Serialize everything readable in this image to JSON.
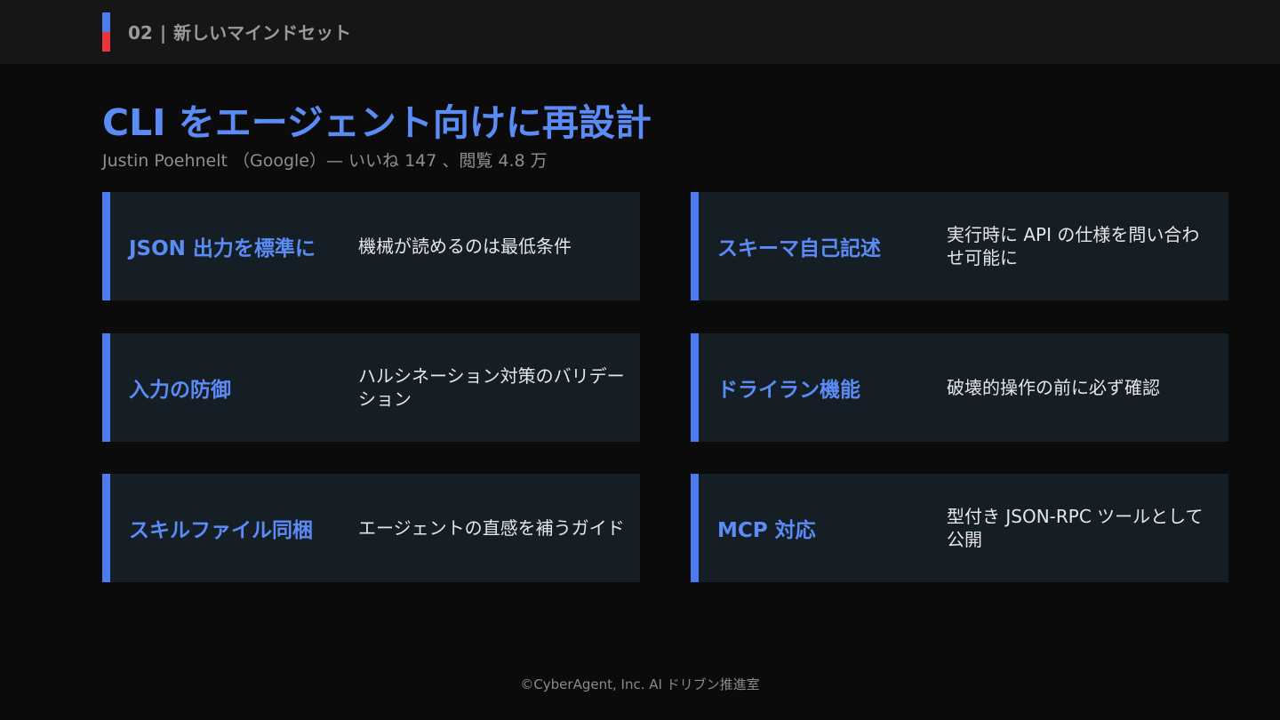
{
  "header": {
    "section_number": "02",
    "separator": "|",
    "section_title": "新しいマインドセット"
  },
  "main": {
    "title": "CLI をエージェント向けに再設計",
    "subtitle": "Justin Poehnelt （Google）— いいね 147 、閲覧 4.8 万"
  },
  "cards": [
    {
      "heading": "JSON 出力を標準に",
      "description": "機械が読めるのは最低条件"
    },
    {
      "heading": "スキーマ自己記述",
      "description": "実行時に API の仕様を問い合わせ可能に"
    },
    {
      "heading": "入力の防御",
      "description": "ハルシネーション対策のバリデーション"
    },
    {
      "heading": "ドライラン機能",
      "description": "破壊的操作の前に必ず確認"
    },
    {
      "heading": "スキルファイル同梱",
      "description": "エージェントの直感を補うガイド"
    },
    {
      "heading": "MCP 対応",
      "description": "型付き JSON-RPC ツールとして公開"
    }
  ],
  "footer": {
    "copyright": "©CyberAgent, Inc. AI ドリブン推進室"
  },
  "colors": {
    "background": "#0b0b0b",
    "header_bar": "#161616",
    "accent_blue": "#4d7cf0",
    "accent_red": "#e8363c",
    "title_blue": "#5b8cf5",
    "card_bg": "#151d25"
  }
}
